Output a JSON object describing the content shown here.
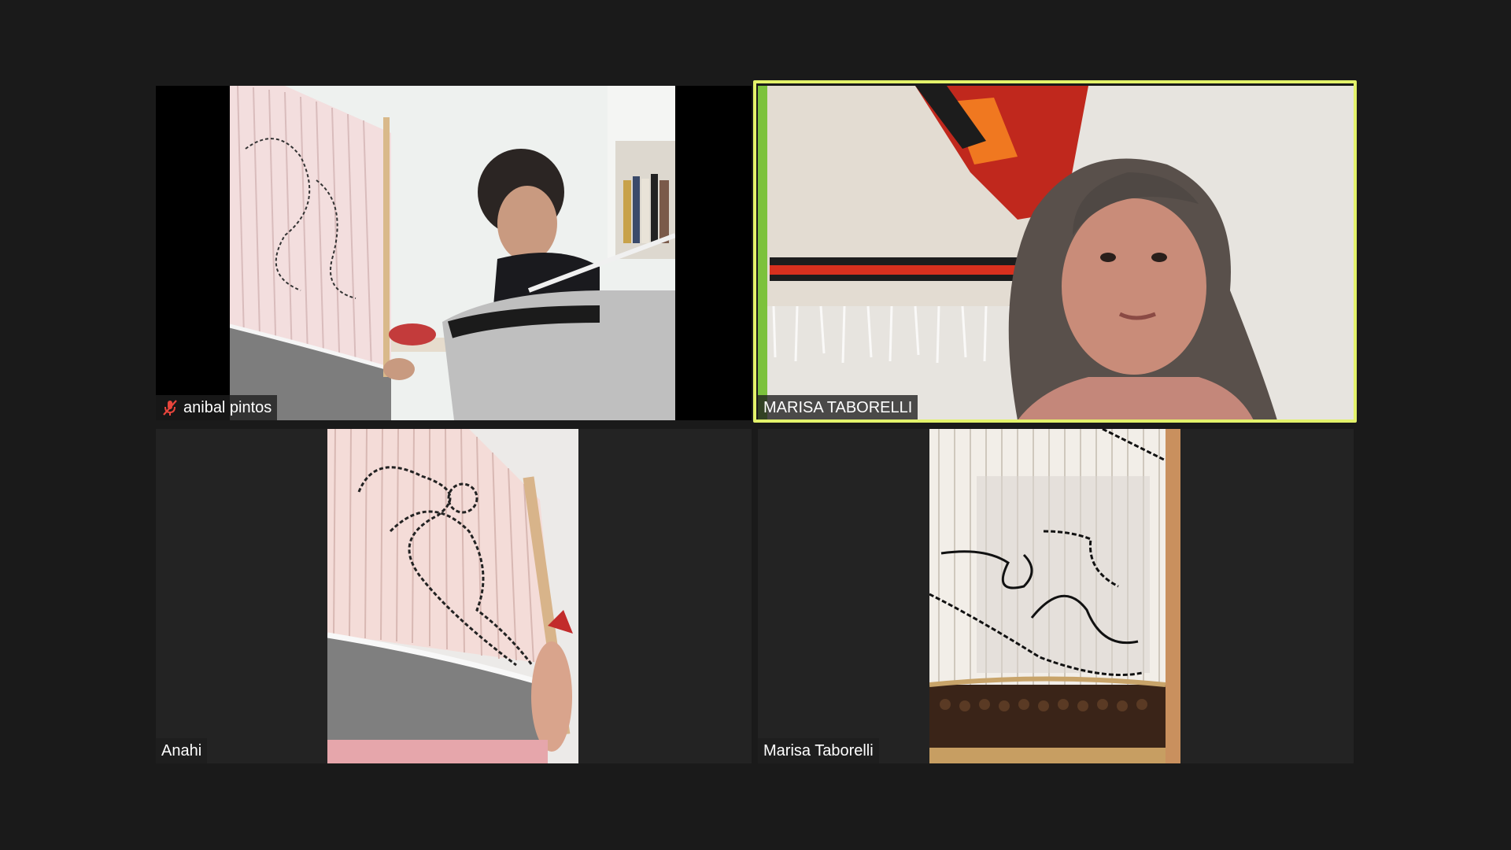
{
  "participants": [
    {
      "name": "anibal pintos",
      "muted": true
    },
    {
      "name": "MARISA TABORELLI",
      "muted": false,
      "active_speaker": true
    },
    {
      "name": "Anahi",
      "muted": false
    },
    {
      "name": "Marisa Taborelli",
      "muted": false
    }
  ],
  "colors": {
    "background": "#1a1a1a",
    "tile": "#232323",
    "active_speaker_border": "#e3f26b",
    "muted_icon": "#e8453c"
  },
  "icons": {
    "muted": "microphone-muted-icon"
  }
}
